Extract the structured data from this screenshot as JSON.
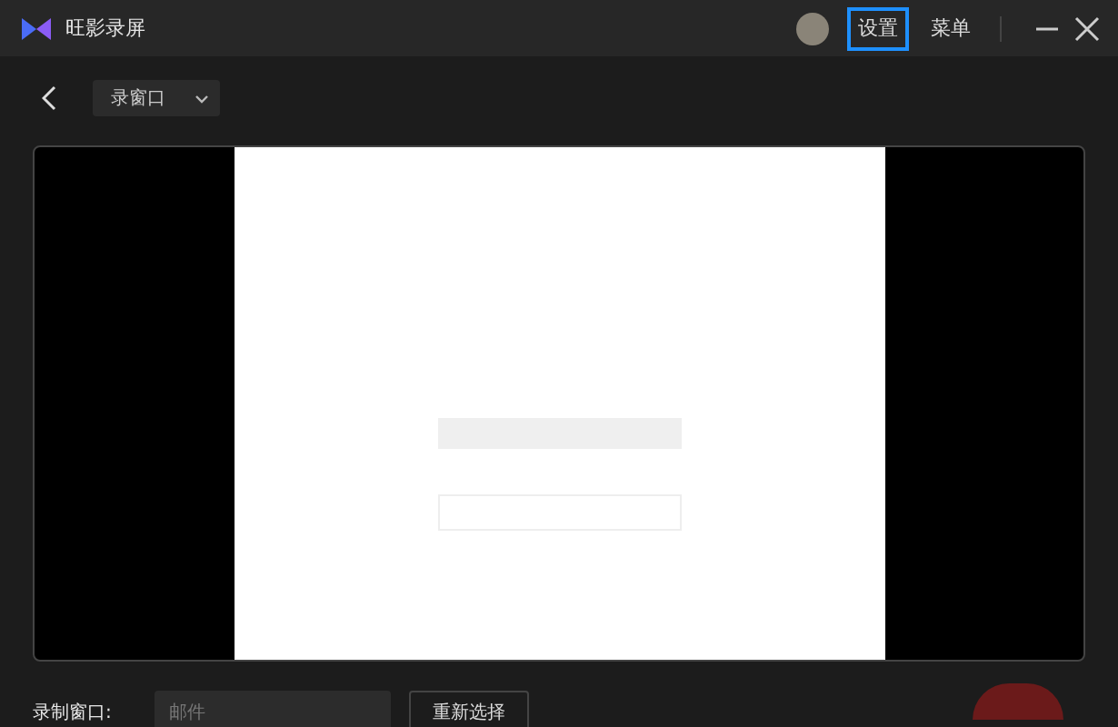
{
  "window": {
    "title": "旺影录屏"
  },
  "header_buttons": [
    {
      "label": "设置",
      "focused": true
    },
    {
      "label": "菜单",
      "focused": false
    }
  ],
  "mode_dropdown": {
    "value": "录窗口"
  },
  "record_window": {
    "label": "录制窗口:",
    "value": "邮件",
    "button": "重新选择"
  }
}
